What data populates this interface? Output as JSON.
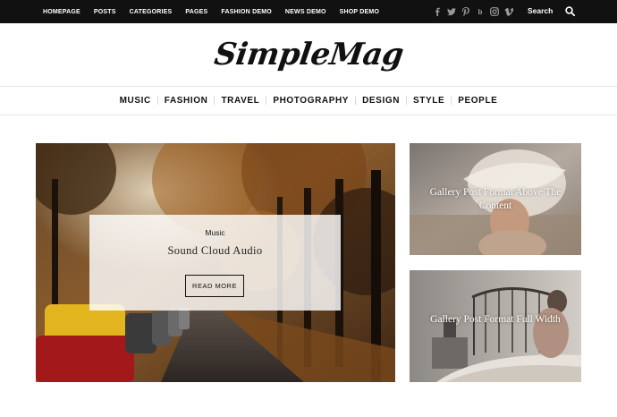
{
  "topbar": {
    "nav": [
      "HOMEPAGE",
      "POSTS",
      "CATEGORIES",
      "PAGES",
      "FASHION DEMO",
      "NEWS DEMO",
      "SHOP DEMO"
    ],
    "social_icons": [
      "facebook-icon",
      "twitter-icon",
      "pinterest-icon",
      "behance-icon",
      "instagram-icon",
      "vimeo-icon"
    ],
    "search_label": "Search"
  },
  "logo": {
    "text": "SimpleMag"
  },
  "categories": [
    "MUSIC",
    "FASHION",
    "TRAVEL",
    "PHOTOGRAPHY",
    "DESIGN",
    "STYLE",
    "PEOPLE"
  ],
  "hero": {
    "category": "Music",
    "title": "Sound Cloud Audio",
    "button": "READ MORE"
  },
  "side_posts": [
    {
      "title": "Gallery Post Format Above The Content"
    },
    {
      "title": "Gallery Post Format Full Width"
    }
  ],
  "colors": {
    "topbar": "#111111",
    "accent": "#111111"
  }
}
